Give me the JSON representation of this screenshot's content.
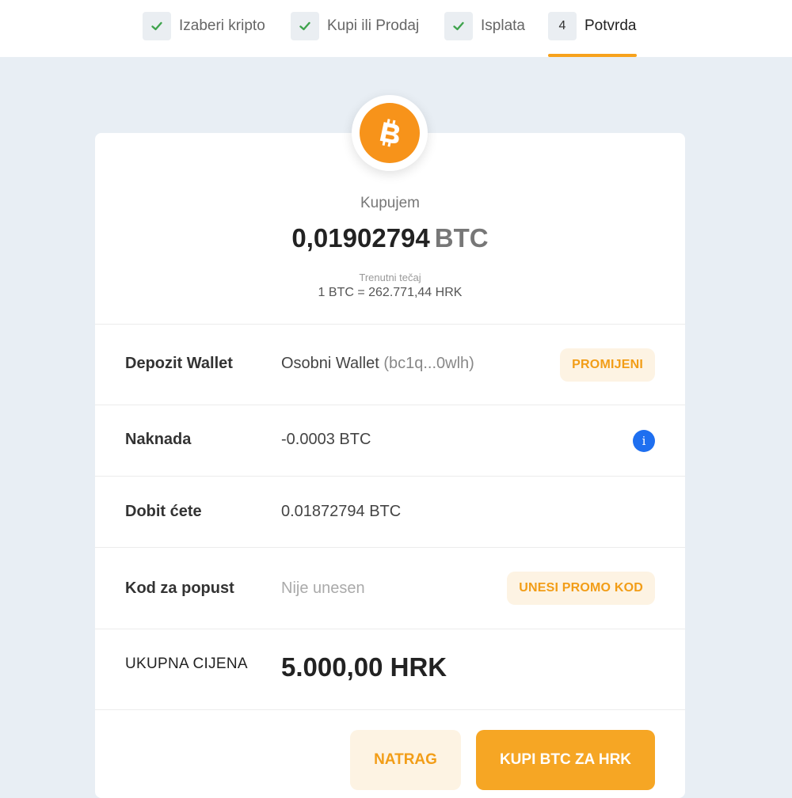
{
  "stepper": {
    "steps": [
      {
        "badge": "✔",
        "label": "Izaberi kripto",
        "state": "done"
      },
      {
        "badge": "✔",
        "label": "Kupi ili Prodaj",
        "state": "done"
      },
      {
        "badge": "✔",
        "label": "Isplata",
        "state": "done"
      },
      {
        "badge": "4",
        "label": "Potvrda",
        "state": "active"
      }
    ]
  },
  "coin": {
    "icon": "bitcoin-icon",
    "color": "#f7931a"
  },
  "summary": {
    "action_label": "Kupujem",
    "amount": "0,01902794",
    "unit": "BTC",
    "rate_label": "Trenutni tečaj",
    "rate_value": "1 BTC = 262.771,44 HRK"
  },
  "rows": {
    "wallet": {
      "label": "Depozit Wallet",
      "value": "Osobni Wallet",
      "address": "(bc1q...0wlh)",
      "action": "PROMIJENI"
    },
    "fee": {
      "label": "Naknada",
      "value": "-0.0003 BTC",
      "info_icon": "info-icon"
    },
    "receive": {
      "label": "Dobit ćete",
      "value": "0.01872794 BTC"
    },
    "promo": {
      "label": "Kod za popust",
      "value": "Nije unesen",
      "action": "UNESI PROMO KOD"
    },
    "total": {
      "label": "UKUPNA CIJENA",
      "value": "5.000,00 HRK"
    }
  },
  "footer": {
    "back_label": "NATRAG",
    "buy_label": "KUPI BTC ZA HRK"
  },
  "colors": {
    "accent": "#f6a624",
    "accent_soft": "#fdf3e3",
    "info": "#1e6ff0",
    "check": "#3fa34d",
    "background": "#e8eef4"
  }
}
